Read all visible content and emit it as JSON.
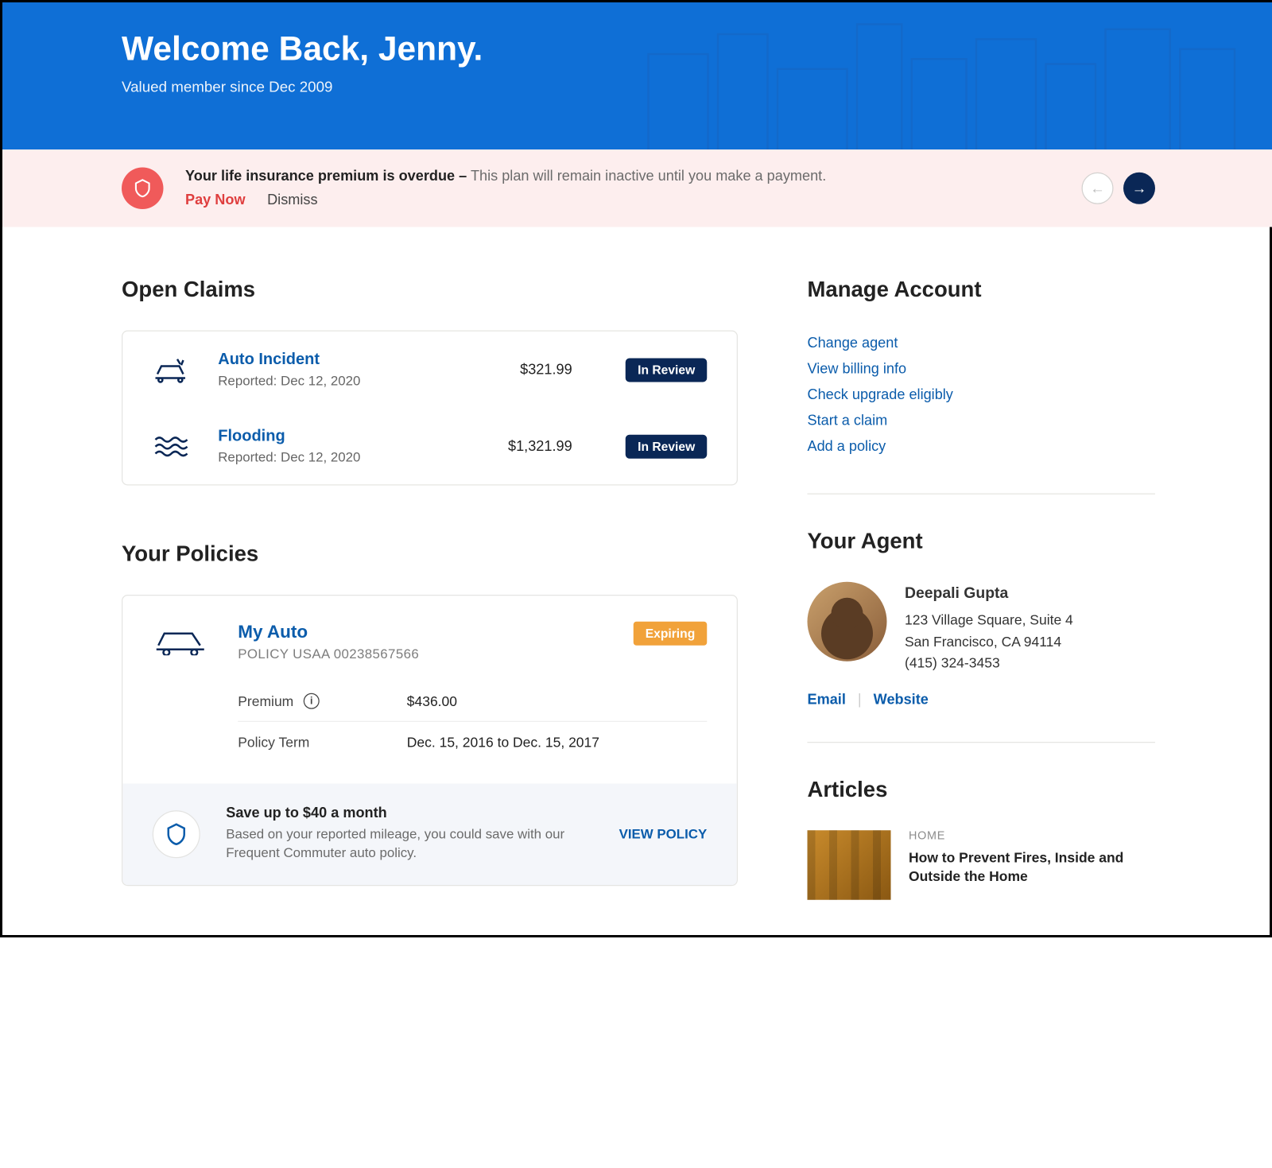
{
  "hero": {
    "title": "Welcome Back, Jenny.",
    "subtitle": "Valued member since Dec 2009"
  },
  "alert": {
    "bold": "Your life insurance premium is overdue –",
    "muted": "This plan will remain inactive until you make a payment.",
    "pay": "Pay Now",
    "dismiss": "Dismiss"
  },
  "open_claims": {
    "heading": "Open Claims",
    "items": [
      {
        "title": "Auto Incident",
        "reported": "Reported: Dec 12, 2020",
        "amount": "$321.99",
        "status": "In Review"
      },
      {
        "title": "Flooding",
        "reported": "Reported: Dec 12, 2020",
        "amount": "$1,321.99",
        "status": "In Review"
      }
    ]
  },
  "policies": {
    "heading": "Your Policies",
    "item": {
      "title": "My Auto",
      "number": "POLICY USAA 00238567566",
      "badge": "Expiring",
      "premium_label": "Premium",
      "premium_value": "$436.00",
      "term_label": "Policy Term",
      "term_value": "Dec. 15, 2016 to Dec. 15, 2017"
    },
    "promo": {
      "title": "Save up to $40 a month",
      "desc": "Based on your reported mileage, you could save with our Frequent Commuter auto policy.",
      "cta": "VIEW POLICY"
    }
  },
  "manage": {
    "heading": "Manage Account",
    "links": [
      "Change agent",
      "View billing info",
      "Check upgrade eligibly",
      "Start a claim",
      "Add a policy"
    ]
  },
  "agent": {
    "heading": "Your Agent",
    "name": "Deepali Gupta",
    "addr1": "123 Village Square, Suite 4",
    "addr2": "San Francisco, CA 94114",
    "phone": "(415) 324-3453",
    "email": "Email",
    "website": "Website"
  },
  "articles": {
    "heading": "Articles",
    "item": {
      "category": "HOME",
      "title": "How to Prevent Fires, Inside and Outside the Home"
    }
  }
}
